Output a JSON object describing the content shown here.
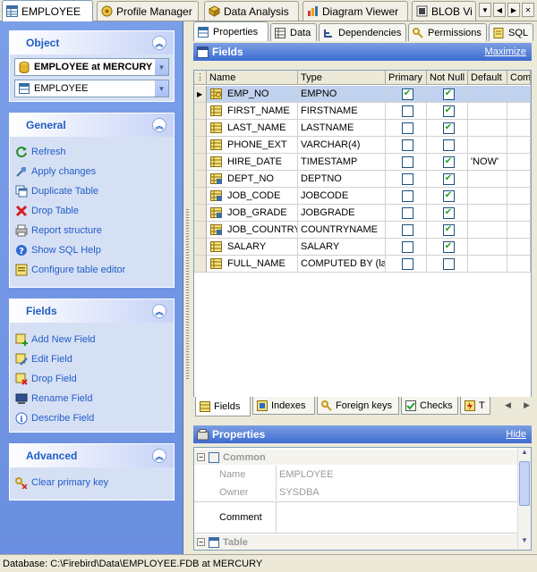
{
  "window_tabs": [
    {
      "label": "EMPLOYEE",
      "icon": "table-icon",
      "active": true
    },
    {
      "label": "Profile Manager",
      "icon": "profile-manager-icon"
    },
    {
      "label": "Data Analysis",
      "icon": "data-analysis-icon"
    },
    {
      "label": "Diagram Viewer",
      "icon": "diagram-icon"
    },
    {
      "label": "BLOB Vi",
      "icon": "blob-icon"
    }
  ],
  "nav": {
    "down": "▼",
    "left": "◀",
    "right": "▶",
    "close": "✕"
  },
  "object_panel": {
    "title": "Object",
    "database_value": "EMPLOYEE at MERCURY",
    "table_value": "EMPLOYEE"
  },
  "general_panel": {
    "title": "General",
    "items": [
      {
        "label": "Refresh",
        "icon": "refresh-icon"
      },
      {
        "label": "Apply changes",
        "icon": "apply-changes-icon"
      },
      {
        "label": "Duplicate Table",
        "icon": "duplicate-table-icon"
      },
      {
        "label": "Drop Table",
        "icon": "drop-icon"
      },
      {
        "label": "Report structure",
        "icon": "printer-icon"
      },
      {
        "label": "Show SQL Help",
        "icon": "help-icon"
      },
      {
        "label": "Configure table editor",
        "icon": "configure-icon"
      }
    ]
  },
  "fields_panel": {
    "title": "Fields",
    "items": [
      {
        "label": "Add New Field",
        "icon": "add-field-icon"
      },
      {
        "label": "Edit Field",
        "icon": "edit-field-icon"
      },
      {
        "label": "Drop Field",
        "icon": "drop-field-icon"
      },
      {
        "label": "Rename Field",
        "icon": "rename-field-icon"
      },
      {
        "label": "Describe Field",
        "icon": "info-icon"
      }
    ]
  },
  "advanced_panel": {
    "title": "Advanced",
    "items": [
      {
        "label": "Clear primary key",
        "icon": "clear-key-icon"
      }
    ]
  },
  "sub_tabs": [
    {
      "label": "Properties",
      "active": true
    },
    {
      "label": "Data"
    },
    {
      "label": "Dependencies"
    },
    {
      "label": "Permissions"
    },
    {
      "label": "SQL"
    }
  ],
  "fields_header": {
    "title": "Fields",
    "link": "Maximize"
  },
  "grid": {
    "columns": [
      "Name",
      "Type",
      "Primary",
      "Not Null",
      "Default",
      "Com"
    ],
    "rows": [
      {
        "name": "EMP_NO",
        "type": "EMPNO",
        "primary": true,
        "not_null": true,
        "default": "",
        "selected": true,
        "key": true
      },
      {
        "name": "FIRST_NAME",
        "type": "FIRSTNAME",
        "primary": false,
        "not_null": true,
        "default": ""
      },
      {
        "name": "LAST_NAME",
        "type": "LASTNAME",
        "primary": false,
        "not_null": true,
        "default": ""
      },
      {
        "name": "PHONE_EXT",
        "type": "VARCHAR(4)",
        "primary": false,
        "not_null": false,
        "default": ""
      },
      {
        "name": "HIRE_DATE",
        "type": "TIMESTAMP",
        "primary": false,
        "not_null": true,
        "default": "'NOW'"
      },
      {
        "name": "DEPT_NO",
        "type": "DEPTNO",
        "primary": false,
        "not_null": true,
        "default": "",
        "fk": true
      },
      {
        "name": "JOB_CODE",
        "type": "JOBCODE",
        "primary": false,
        "not_null": true,
        "default": "",
        "fk": true
      },
      {
        "name": "JOB_GRADE",
        "type": "JOBGRADE",
        "primary": false,
        "not_null": true,
        "default": "",
        "fk": true
      },
      {
        "name": "JOB_COUNTRY",
        "type": "COUNTRYNAME",
        "primary": false,
        "not_null": true,
        "default": "",
        "fk": true
      },
      {
        "name": "SALARY",
        "type": "SALARY",
        "primary": false,
        "not_null": true,
        "default": ""
      },
      {
        "name": "FULL_NAME",
        "type": "COMPUTED BY (last_",
        "primary": false,
        "not_null": false,
        "default": ""
      }
    ]
  },
  "bottom_tabs": [
    {
      "label": "Fields",
      "active": true
    },
    {
      "label": "Indexes"
    },
    {
      "label": "Foreign keys"
    },
    {
      "label": "Checks"
    },
    {
      "label": "T"
    }
  ],
  "properties_header": {
    "title": "Properties",
    "link": "Hide"
  },
  "properties": {
    "common_label": "Common",
    "name_label": "Name",
    "name_value": "EMPLOYEE",
    "owner_label": "Owner",
    "owner_value": "SYSDBA",
    "comment_label": "Comment",
    "table_label": "Table"
  },
  "status": {
    "text": "Database: C:\\Firebird\\Data\\EMPLOYEE.FDB at MERCURY"
  }
}
